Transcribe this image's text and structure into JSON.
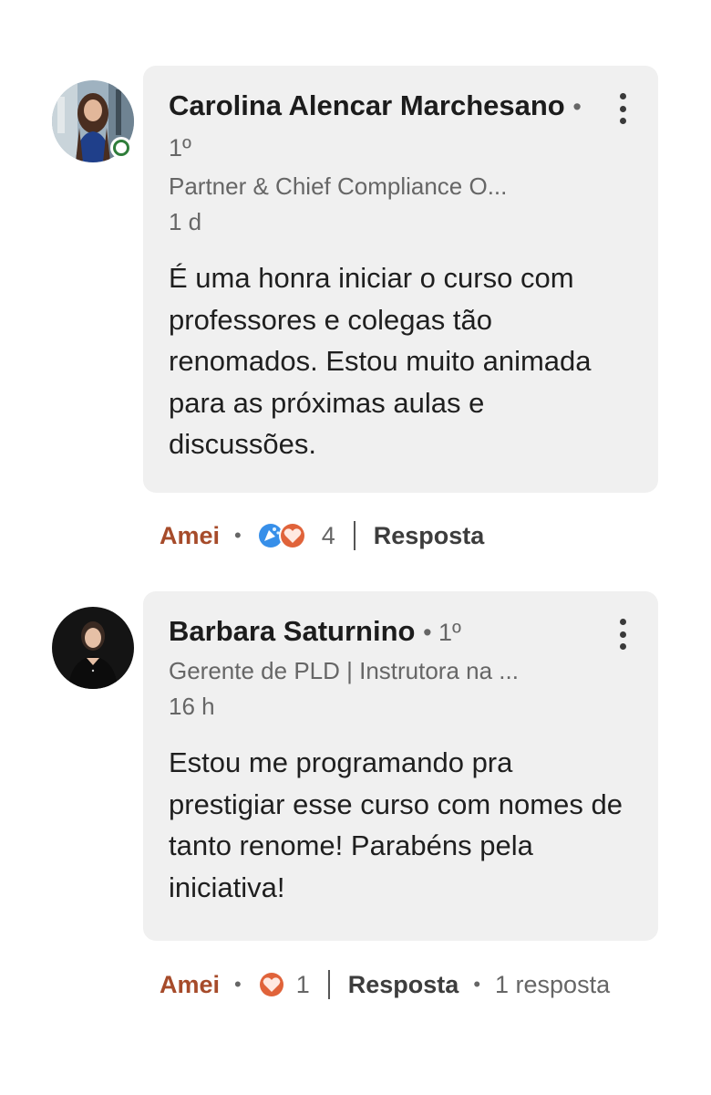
{
  "comments": [
    {
      "author": "Carolina Alencar Marchesano",
      "degree": "• 1º",
      "headline": "Partner & Chief Compliance O...",
      "time": "1 d",
      "text": "É uma honra iniciar o curso com professores e colegas tão renomados. Estou muito animada para as próximas aulas e discussões.",
      "online": true,
      "reaction_label": "Amei",
      "reaction_icons": [
        "celebrate-icon",
        "love-icon"
      ],
      "reaction_count": "4",
      "reply_label": "Resposta"
    },
    {
      "author": "Barbara Saturnino",
      "degree": "• 1º",
      "headline": "Gerente de PLD | Instrutora na ...",
      "time": "16 h",
      "text": "Estou me programando pra prestigiar esse curso com nomes de tanto renome! Parabéns pela iniciativa!",
      "online": false,
      "reaction_label": "Amei",
      "reaction_icons": [
        "love-icon"
      ],
      "reaction_count": "1",
      "reply_label": "Resposta",
      "replies_label": "1 resposta"
    }
  ],
  "colors": {
    "bubble": "#f0f0f0",
    "love_label": "#a64b2a",
    "online_ring": "#2f7d3a",
    "love_icon": "#e0633a",
    "celebrate_icon": "#378fe9"
  }
}
